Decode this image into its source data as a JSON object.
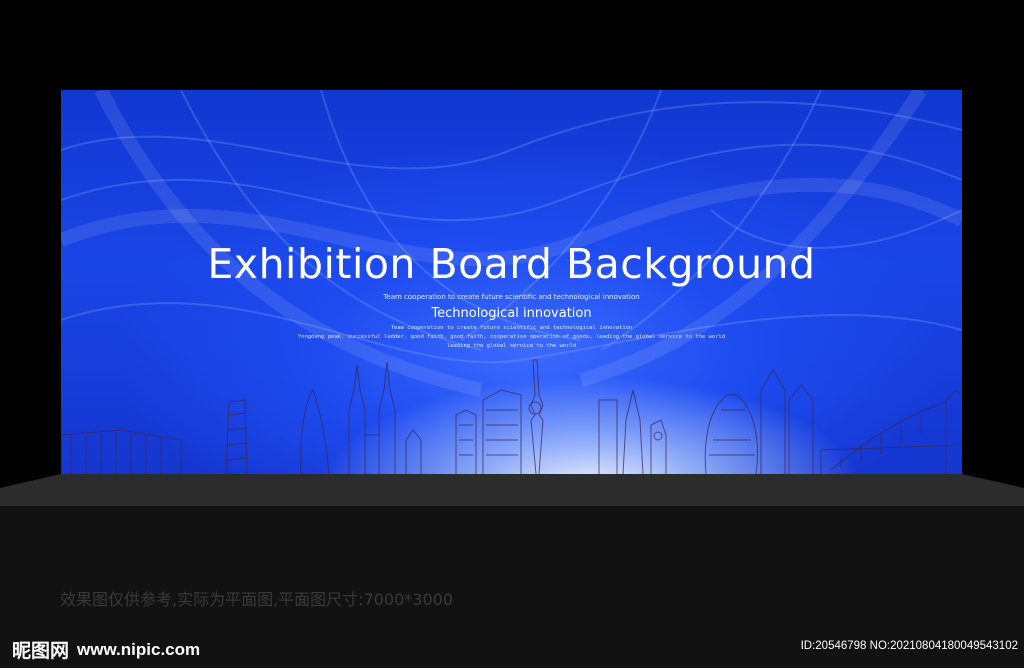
{
  "board": {
    "title": "Exhibition Board Background",
    "subtitle_small": "Team cooperation to create future scientific and technological innovation",
    "subtitle_main": "Technological innovation",
    "body_line1": "Team cooperation to create future scientific and technological innovation",
    "body_line2": "Yongdeng peak, successful ladder, good faith, good faith, cooperative operation of goods, leading the global service to the world",
    "body_line3": "leading the global service to the world"
  },
  "footer": {
    "note": "效果图仅供参考,实际为平面图,平面图尺寸:7000*3000",
    "logo_text": "昵图网",
    "logo_url": "www.nipic.com",
    "id_line": "ID:20546798 NO:20210804180049543102"
  },
  "colors": {
    "background": "#000000",
    "board_blue": "#1a45e6",
    "stage_gray": "#2a2a2a"
  }
}
